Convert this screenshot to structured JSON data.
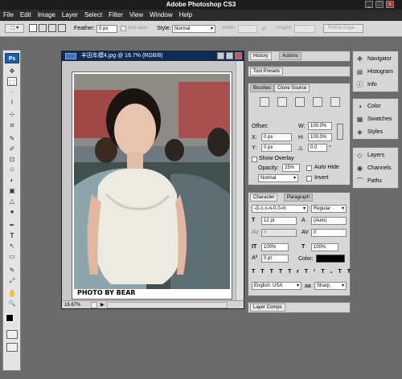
{
  "app": {
    "title": "Adobe Photoshop CS3",
    "min": "_",
    "max": "□",
    "close": "x"
  },
  "menu": [
    "File",
    "Edit",
    "Image",
    "Layer",
    "Select",
    "Filter",
    "View",
    "Window",
    "Help"
  ],
  "options": {
    "feather_label": "Feather:",
    "feather_value": "0 px",
    "antialias_label": "Anti-alias",
    "style_label": "Style:",
    "style_value": "Normal",
    "width_label": "Width:",
    "height_label": "Height:",
    "refine_label": "Refine Edge..."
  },
  "toolbox": {
    "ps_label": "Ps",
    "tools": [
      "✥",
      "⬚",
      "◌",
      "⌇",
      "⊹",
      "⧄",
      "✎",
      "✐",
      "⊡",
      "♲",
      "◐",
      "▣",
      "△",
      "●",
      "✒",
      "T",
      "↖",
      "▭",
      "✋",
      "🔍",
      "Q"
    ]
  },
  "document": {
    "title": "丰田车模4.jpg @ 16.7% (RGB/8)",
    "watermark": "PHOTO BY BEAR",
    "zoom": "16.67%",
    "status_arrow": "▶"
  },
  "history_panel": {
    "tabs": [
      "History",
      "Actions"
    ]
  },
  "toolpresets_panel": {
    "tabs": [
      "Tool Presets"
    ]
  },
  "clone_panel": {
    "tabs": [
      "Brushes",
      "Clone Source"
    ],
    "offset_label": "Offset:",
    "w_label": "W:",
    "w_value": "100.0%",
    "x_label": "X:",
    "x_value": "0 px",
    "h_label": "H:",
    "h_value": "100.0%",
    "y_label": "Y:",
    "y_value": "0 px",
    "angle_value": "0.0",
    "angle_unit": "°",
    "show_overlay": "Show Overlay",
    "opacity_label": "Opacity:",
    "opacity_value": "25%",
    "auto_hide": "Auto Hide",
    "mode_value": "Normal",
    "invert": "Invert"
  },
  "character_panel": {
    "tabs": [
      "Character",
      "Paragraph"
    ],
    "font_family": "-G-c-s-n-0-0-m",
    "font_style": "Regular",
    "font_size": "12 pt",
    "leading": "(Auto)",
    "kerning": "0",
    "tracking": "0",
    "vscale": "100%",
    "hscale": "100%",
    "baseline": "0 pt",
    "color_label": "Color:",
    "styles": [
      "T",
      "T",
      "TT",
      "Tr",
      "T¹",
      "T₁",
      "T",
      "Ŧ"
    ],
    "language": "English: USA",
    "aa_label": "aa",
    "antialias": "Sharp"
  },
  "layercomps_panel": {
    "tabs": [
      "Layer Comps"
    ]
  },
  "dock": {
    "group1": [
      "Navigator",
      "Histogram",
      "Info"
    ],
    "group2": [
      "Color",
      "Swatches",
      "Styles"
    ],
    "group3": [
      "Layers",
      "Channels",
      "Paths"
    ]
  }
}
